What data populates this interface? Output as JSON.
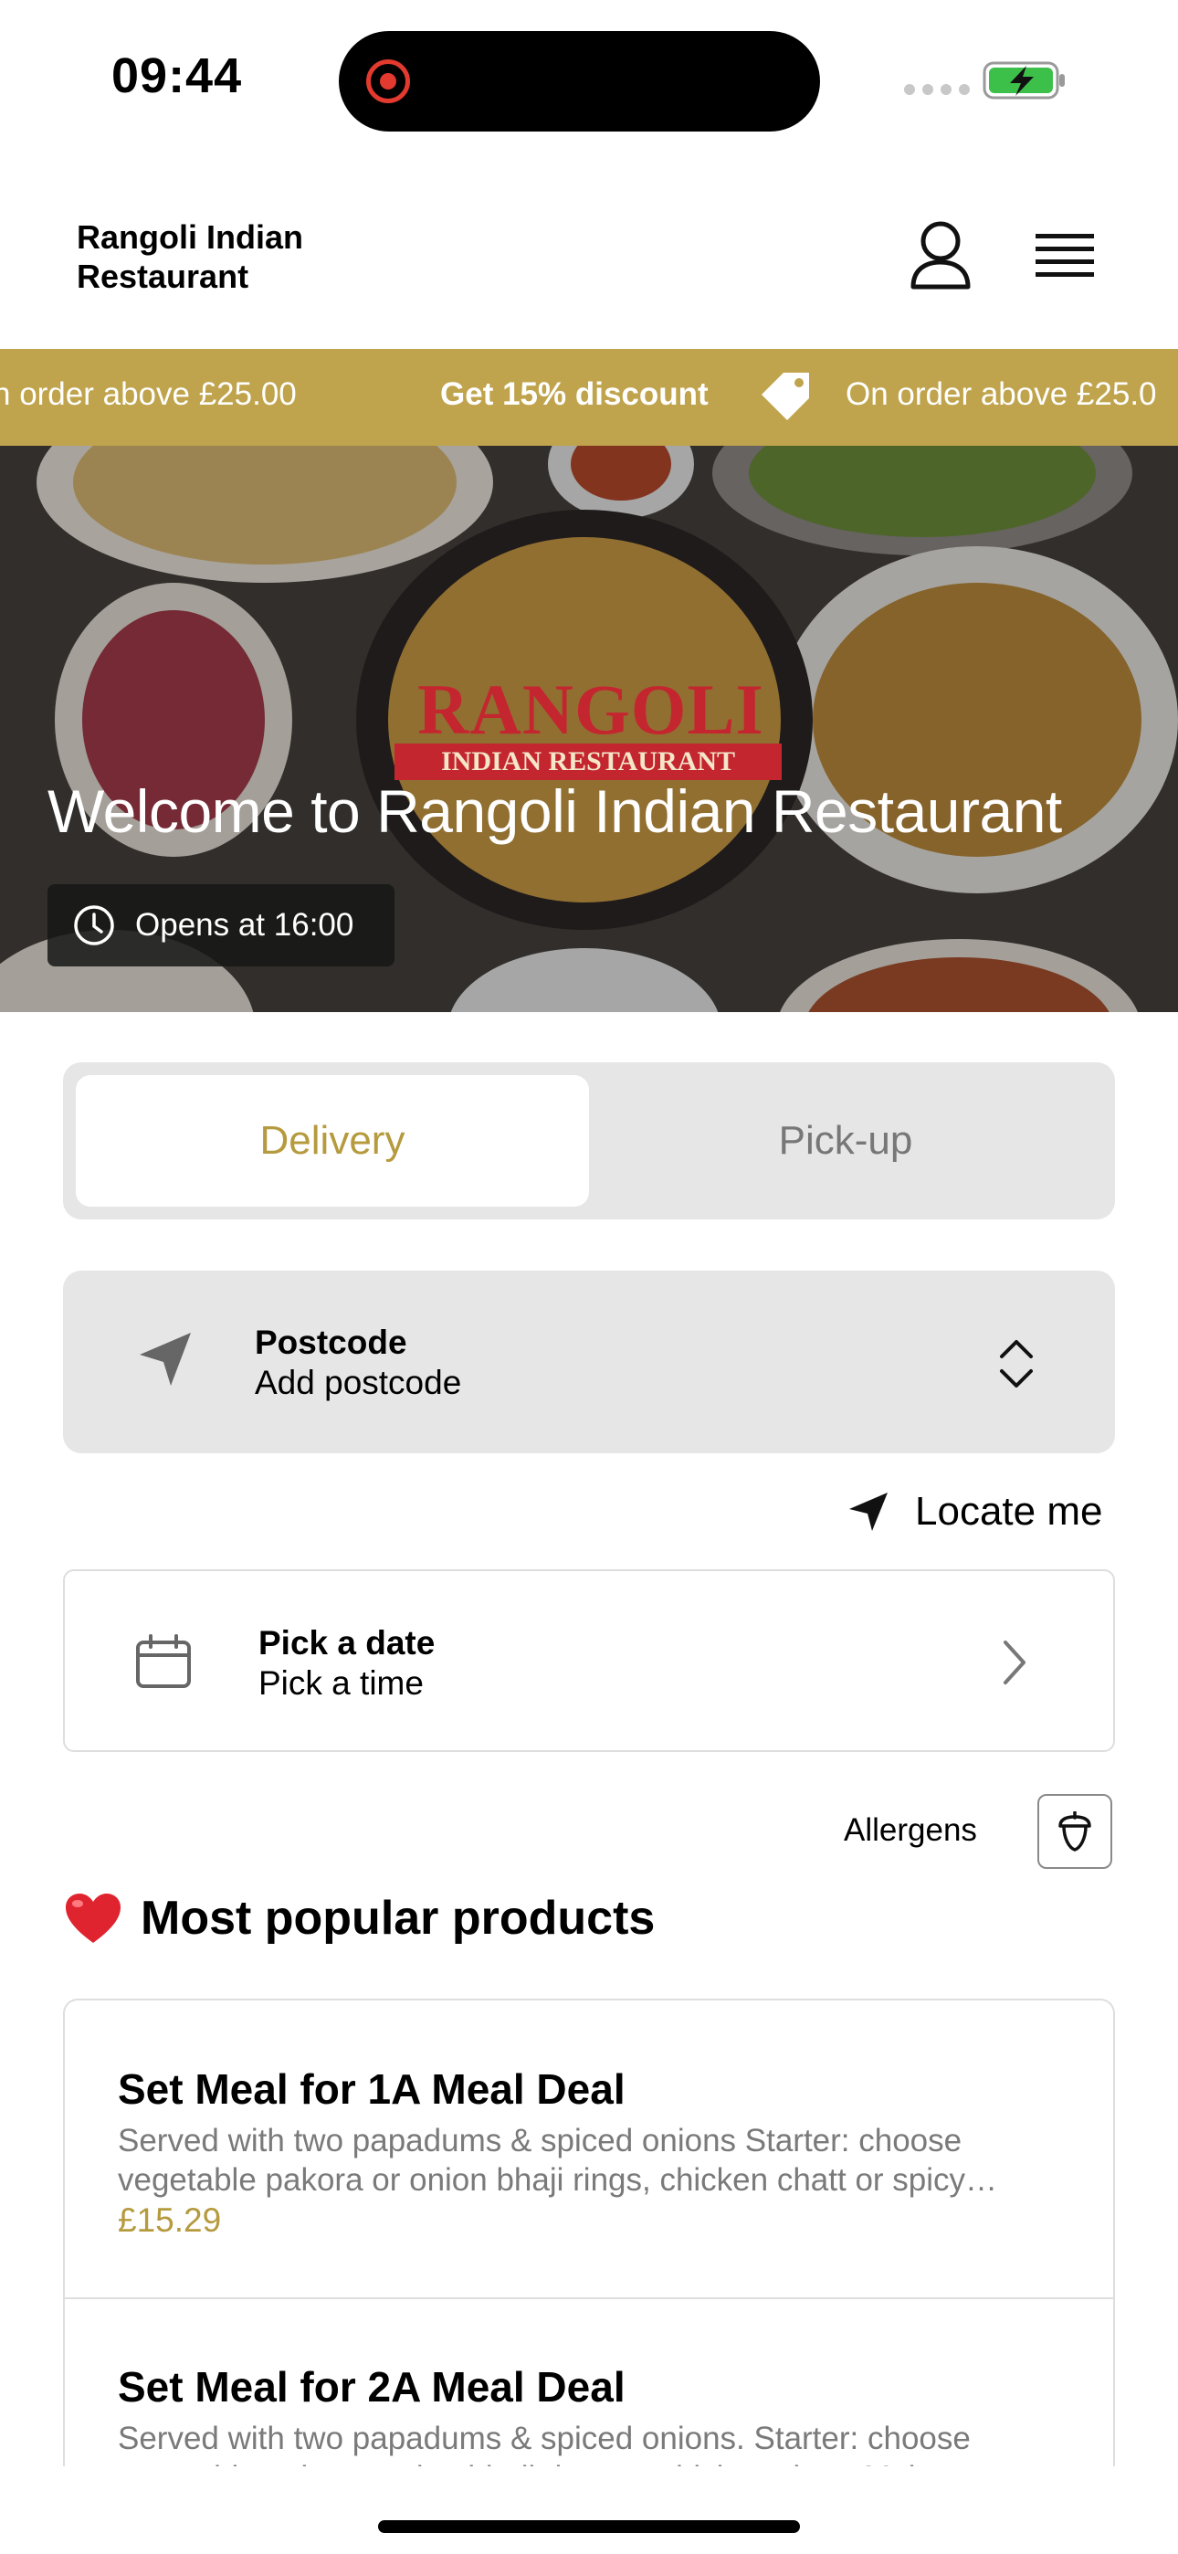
{
  "status_bar": {
    "time": "09:44"
  },
  "header": {
    "brand": "Rangoli Indian Restaurant"
  },
  "promo": {
    "left_text": "n order above £25.00",
    "discount_text": "Get 15% discount",
    "right_text": "On order above £25.0"
  },
  "hero": {
    "logo_word": "RANGOLI",
    "logo_sub": "INDIAN RESTAURANT",
    "title": "Welcome to Rangoli Indian Restaurant",
    "hours": "Opens at 16:00"
  },
  "order_mode": {
    "options": [
      "Delivery",
      "Pick-up"
    ],
    "selected": "Delivery"
  },
  "postcode": {
    "label": "Postcode",
    "value": "Add postcode"
  },
  "locate": {
    "label": "Locate me"
  },
  "schedule": {
    "date_label": "Pick a date",
    "time_label": "Pick a time"
  },
  "allergens": {
    "label": "Allergens"
  },
  "popular": {
    "emoji": "❤️",
    "heading": "Most popular products",
    "items": [
      {
        "name": "Set Meal for 1A Meal Deal",
        "description": "Served with two papadums & spiced onions Starter: choose vegetable pakora or onion bhaji rings, chicken chatt or spicy…",
        "price": "£15.29"
      },
      {
        "name": "Set Meal for 2A Meal Deal",
        "description": "Served with two papadums & spiced onions. Starter: choose vegetable pakora, onion bhaji rings or chicken chatt. Main m…"
      }
    ]
  },
  "colors": {
    "accent_gold": "#c0a44d",
    "text_gold": "#b59a3e",
    "panel_grey": "#e6e6e6"
  }
}
